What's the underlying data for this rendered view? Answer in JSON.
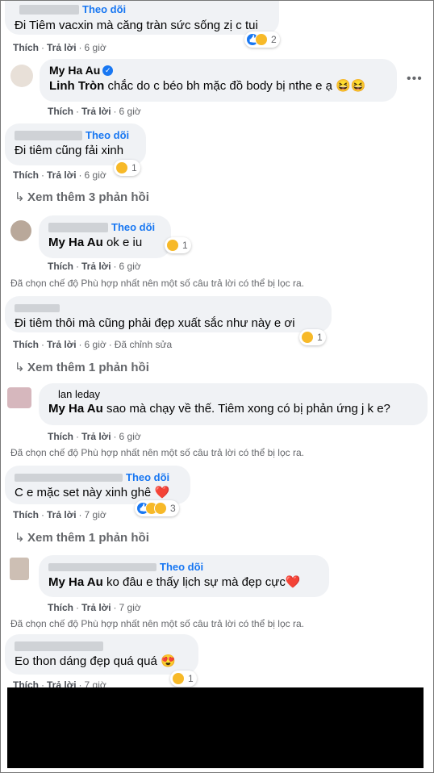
{
  "common": {
    "like": "Thích",
    "reply": "Trả lời",
    "follow": "Theo dõi"
  },
  "comments": [
    {
      "name": "",
      "text": "Đi Tiêm vacxin mà căng tràn sức sống zị c tui",
      "time": "6 giờ",
      "reacts": "2"
    },
    {
      "name": "My Ha Au",
      "mention": "Linh Tròn",
      "text": "chắc do c béo bh mặc đồ body bị nthe e ạ",
      "emoji": "😆😆",
      "time": "6 giờ"
    },
    {
      "name": "",
      "text": "Đi tiêm cũng fải xinh",
      "time": "6 giờ",
      "reacts": "1"
    },
    {
      "name": "",
      "mention": "My Ha Au",
      "text": "ok e iu",
      "time": "6 giờ",
      "reacts": "1"
    },
    {
      "name": "",
      "text": "Đi tiêm thôi mà cũng phải đẹp xuất sắc như này e ơi",
      "time": "6 giờ",
      "edited": "Đã chỉnh sửa",
      "reacts": "1"
    },
    {
      "name": "lan leday",
      "mention": "My Ha Au",
      "text": "sao mà chạy về thế. Tiêm xong có bị phản ứng j k e?",
      "time": "6 giờ"
    },
    {
      "name": "",
      "text": "C e mặc set này xinh ghê",
      "emoji": "❤️",
      "time": "7 giờ",
      "reacts": "3"
    },
    {
      "name": "",
      "mention": "My Ha Au",
      "text": "ko đâu e thấy lịch sự mà đẹp cực",
      "emoji": "❤️",
      "time": "7 giờ"
    },
    {
      "name": "",
      "text": "Eo thon dáng đẹp quá quá",
      "emoji": "😍",
      "time": "7 giờ",
      "reacts": "1"
    }
  ],
  "view_more": [
    "Xem thêm 3 phản hồi",
    "Xem thêm 1 phản hồi",
    "Xem thêm 1 phản hồi"
  ],
  "filter_note": "Đã chọn chế độ Phù hợp nhất nên một số câu trả lời có thể bị lọc ra.",
  "colors": {
    "accent": "#1877f2",
    "bubble": "#f0f2f5",
    "meta": "#65676b"
  }
}
